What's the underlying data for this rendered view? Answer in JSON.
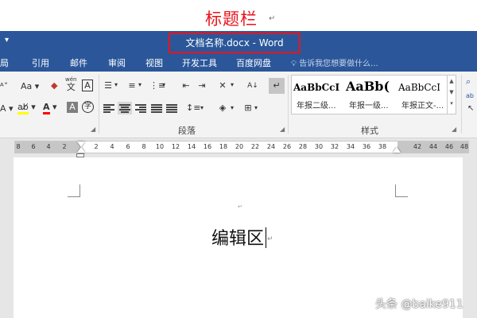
{
  "annotation": {
    "title_bar_label": "标题栏",
    "title_bar_mark": "↵",
    "edit_area_label": "编辑区",
    "edit_area_mark": "↵",
    "small_mark": "↵"
  },
  "titlebar": {
    "document_title": "文档名称.docx - Word",
    "qat_dropdown_icon": "qat-dropdown"
  },
  "ribbon_tabs": [
    "局",
    "引用",
    "邮件",
    "审阅",
    "视图",
    "开发工具",
    "百度网盘"
  ],
  "tell_me": {
    "icon": "lightbulb",
    "text": "告诉我您想要做什么..."
  },
  "ribbon": {
    "font_group": {
      "change_case_label": "Aa",
      "phonetic_label": "wén",
      "phonetic_char": "文",
      "char_border_label": "A",
      "font_color_label": "A",
      "char_shading_label": "A",
      "enclose_label": "字"
    },
    "paragraph_group": {
      "label": "段落",
      "sort_label": "A↓",
      "show_marks_label": "↵"
    },
    "styles_group": {
      "label": "样式",
      "styles": [
        {
          "sample": "AaBbCcI",
          "name": "年报二级..."
        },
        {
          "sample": "AaBb(",
          "name": "年报一级..."
        },
        {
          "sample": "AaBbCcI",
          "name": "年报正文-..."
        }
      ],
      "find_label": "ab"
    }
  },
  "ruler": {
    "ticks": [
      "8",
      "6",
      "4",
      "2",
      "2",
      "4",
      "6",
      "8",
      "10",
      "12",
      "14",
      "16",
      "18",
      "20",
      "22",
      "24",
      "26",
      "28",
      "30",
      "32",
      "34",
      "36",
      "38",
      "42",
      "44",
      "46",
      "48"
    ]
  },
  "watermark": "头条 @baike911",
  "colors": {
    "word_blue": "#2b579a",
    "annotation_red": "#e8141c",
    "highlight_yellow": "#ffff00",
    "font_color_red": "#ff0000"
  }
}
